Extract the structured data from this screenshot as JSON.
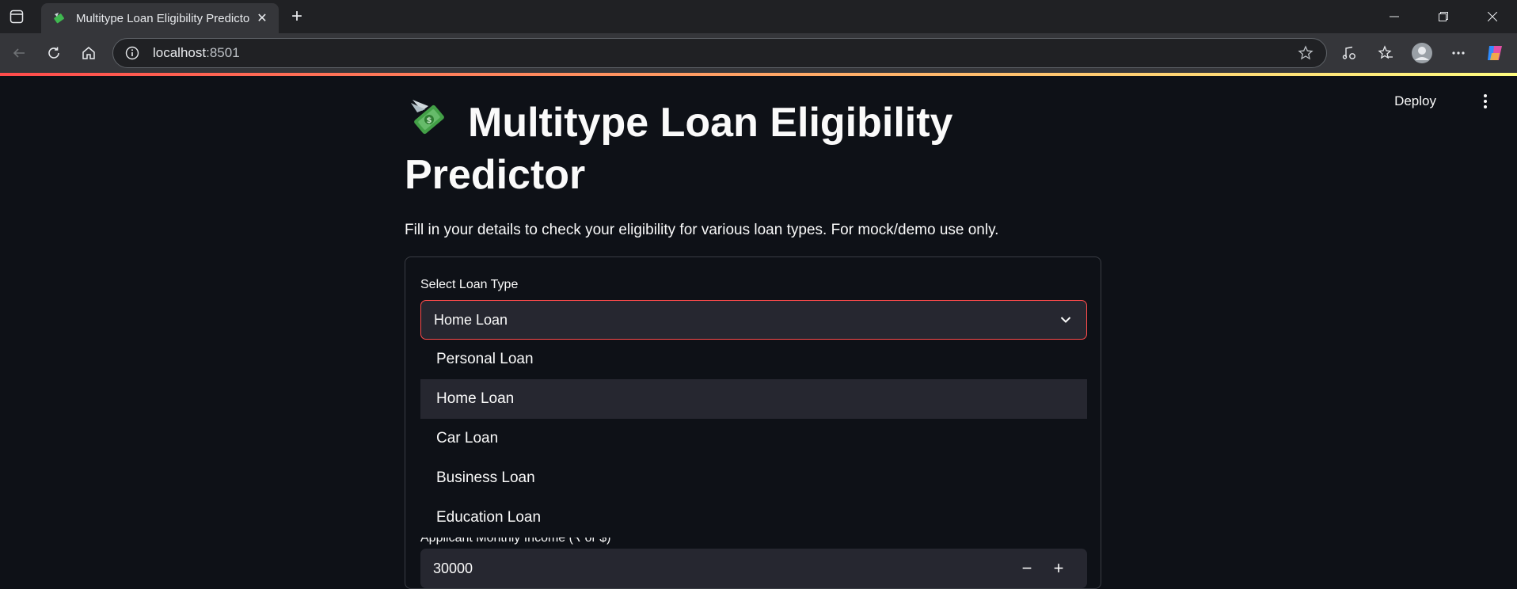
{
  "browser": {
    "tab_title": "Multitype Loan Eligibility Predicto",
    "tab_icon": "money-with-wings-emoji",
    "url_host": "localhost",
    "url_port": ":8501"
  },
  "app": {
    "deploy_label": "Deploy",
    "title": "Multitype Loan Eligibility Predictor",
    "subtitle": "Fill in your details to check your eligibility for various loan types. For mock/demo use only.",
    "loan_type": {
      "label": "Select Loan Type",
      "selected": "Home Loan",
      "options": [
        "Personal Loan",
        "Home Loan",
        "Car Loan",
        "Business Loan",
        "Education Loan"
      ]
    },
    "income": {
      "label": "Applicant Monthly Income (₹ or $)",
      "value": "30000",
      "minus": "−",
      "plus": "+"
    }
  },
  "colors": {
    "accent": "#ff4b4b",
    "background": "#0e1117",
    "widget": "#262730"
  }
}
